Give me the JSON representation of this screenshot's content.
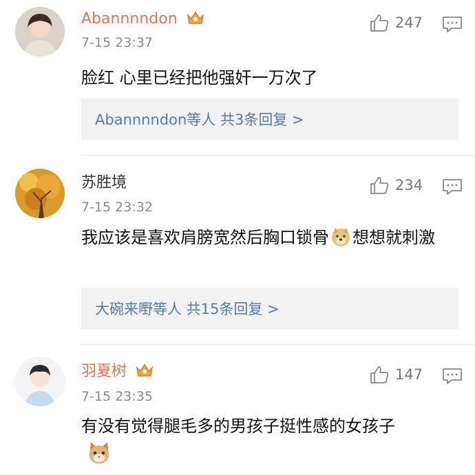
{
  "comments": [
    {
      "username": "Abannnndon",
      "vip": true,
      "time": "7-15 23:37",
      "likes": "247",
      "text": "脸红 心里已经把他强奸一万次了",
      "reply_summary": "Abannnndon等人  共3条回复 >"
    },
    {
      "username": "苏胜境",
      "vip": false,
      "time": "7-15 23:32",
      "likes": "234",
      "text_part1": "我应该是喜欢肩膀宽然后胸口锁骨",
      "text_part2": "想想就刺激",
      "reply_summary": "大碗来嘢等人  共15条回复 >"
    },
    {
      "username": "羽夏树",
      "vip": true,
      "time": "7-15 23:35",
      "likes": "147",
      "text": "有没有觉得腿毛多的男孩子挺性感的女孩子"
    }
  ],
  "icons": {
    "like": "thumbs-up-icon",
    "reply": "comment-icon",
    "vip": "crown-icon"
  },
  "colors": {
    "vip_name": "#eb7350",
    "link": "#507daf",
    "meta": "#8a8a8a",
    "reply_bg": "#f2f2f2"
  }
}
